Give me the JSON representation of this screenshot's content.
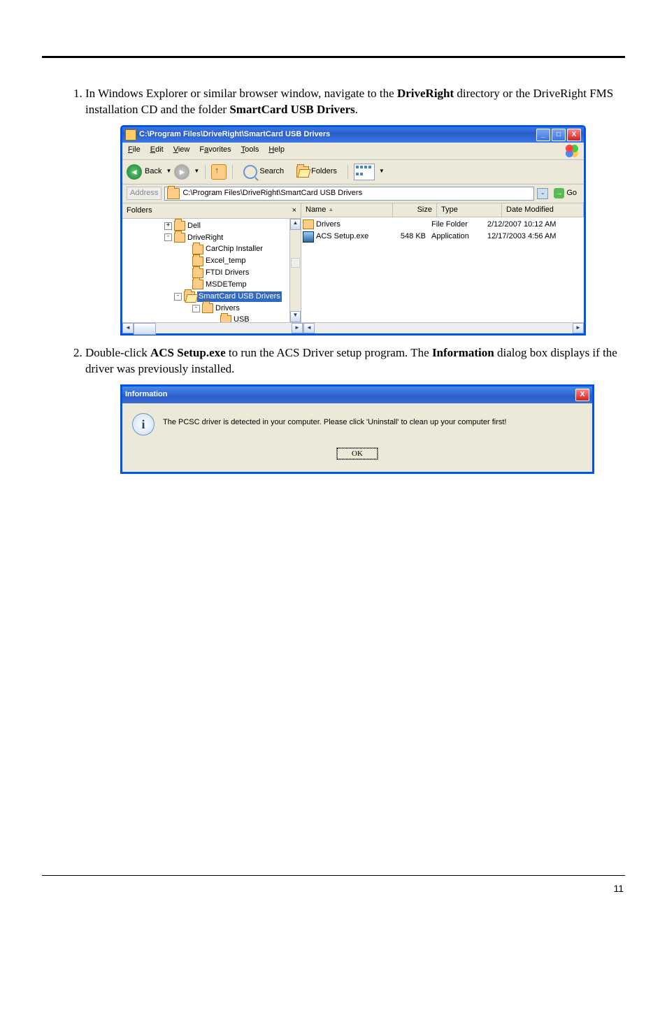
{
  "step1": {
    "intro": "In Windows Explorer or similar browser window, navigate to the ",
    "b1": "DriveRight",
    "mid": " directory or the DriveRight FMS installation CD and the folder ",
    "b2": "SmartCard USB Drivers",
    "end": "."
  },
  "step2": {
    "intro": "Double-click ",
    "b1": "ACS Setup.exe",
    "mid": " to run the ACS Driver setup program. The ",
    "b2": "Information",
    "end": " dialog box displays if the driver was previously installed."
  },
  "explorer": {
    "title": "C:\\Program Files\\DriveRight\\SmartCard USB Drivers",
    "menu": {
      "file": "File",
      "edit": "Edit",
      "view": "View",
      "fav": "Favorites",
      "tools": "Tools",
      "help": "Help"
    },
    "toolbar": {
      "back": "Back",
      "search": "Search",
      "folders": "Folders"
    },
    "address": {
      "label": "Address",
      "path": "C:\\Program Files\\DriveRight\\SmartCard USB Drivers",
      "go": "Go"
    },
    "tree": {
      "header": "Folders",
      "items": [
        {
          "indent": 60,
          "expand": "+",
          "label": "Dell"
        },
        {
          "indent": 60,
          "expand": "-",
          "label": "DriveRight"
        },
        {
          "indent": 86,
          "expand": "",
          "label": "CarChip Installer"
        },
        {
          "indent": 86,
          "expand": "",
          "label": "Excel_temp"
        },
        {
          "indent": 86,
          "expand": "",
          "label": "FTDI Drivers"
        },
        {
          "indent": 86,
          "expand": "",
          "label": "MSDETemp"
        },
        {
          "indent": 74,
          "expand": "-",
          "label": "SmartCard USB Drivers",
          "selected": true,
          "open": true
        },
        {
          "indent": 100,
          "expand": "-",
          "label": "Drivers"
        },
        {
          "indent": 126,
          "expand": "",
          "label": "USB"
        }
      ]
    },
    "list": {
      "cols": {
        "name": "Name",
        "size": "Size",
        "type": "Type",
        "date": "Date Modified"
      },
      "rows": [
        {
          "icon": "folder",
          "name": "Drivers",
          "size": "",
          "type": "File Folder",
          "date": "2/12/2007 10:12 AM"
        },
        {
          "icon": "app",
          "name": "ACS Setup.exe",
          "size": "548 KB",
          "type": "Application",
          "date": "12/17/2003 4:56 AM"
        }
      ]
    }
  },
  "dialog": {
    "title": "Information",
    "msg": "The PCSC driver is detected in your computer. Please click 'Uninstall' to clean up your computer first!",
    "ok": "OK"
  },
  "pagenum": "11"
}
